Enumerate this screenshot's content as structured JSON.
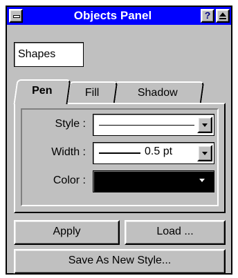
{
  "window": {
    "title": "Objects Panel",
    "help_label": "?"
  },
  "shapes_field": {
    "value": "Shapes"
  },
  "tabs": [
    {
      "label": "Pen",
      "active": true
    },
    {
      "label": "Fill",
      "active": false
    },
    {
      "label": "Shadow",
      "active": false
    }
  ],
  "pen": {
    "style_label": "Style :",
    "width_label": "Width :",
    "width_value": "0.5 pt",
    "color_label": "Color :",
    "color_value": "#000000"
  },
  "buttons": {
    "apply_label": "Apply",
    "load_label": "Load ...",
    "save_label": "Save As New Style..."
  },
  "colors": {
    "title_bar": "#0000ff",
    "panel": "#c0c0c0"
  }
}
